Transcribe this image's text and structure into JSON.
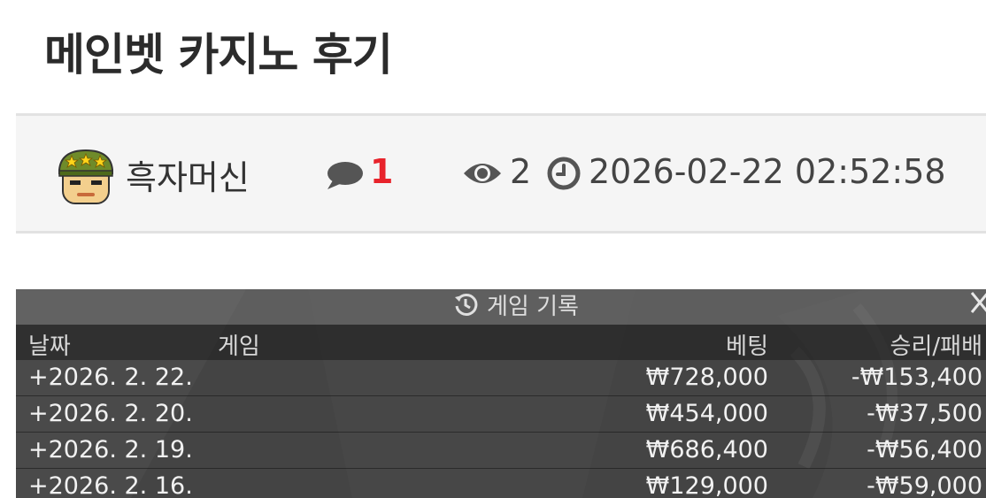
{
  "post": {
    "title": "메인벳 카지노 후기",
    "author": "흑자머신",
    "comment_count": "1",
    "views": "2",
    "datetime": "2026-02-22 02:52:58"
  },
  "game_history": {
    "title": "게임 기록",
    "columns": [
      "날짜",
      "게임",
      "베팅",
      "승리/패배"
    ],
    "rows": [
      {
        "date": "+2026. 2. 22.",
        "game": "",
        "bet": "₩728,000",
        "result": "-₩153,400"
      },
      {
        "date": "+2026. 2. 20.",
        "game": "",
        "bet": "₩454,000",
        "result": "-₩37,500"
      },
      {
        "date": "+2026. 2. 19.",
        "game": "",
        "bet": "₩686,400",
        "result": "-₩56,400"
      },
      {
        "date": "+2026. 2. 16.",
        "game": "",
        "bet": "₩129,000",
        "result": "-₩59,000"
      }
    ]
  },
  "icons": {
    "comment": "comment-icon",
    "views": "eye-icon",
    "time": "clock-icon",
    "history": "history-icon",
    "close": "close-icon"
  },
  "colors": {
    "comment_count": "#e8232b",
    "meta_bar_bg": "#f5f5f5",
    "icon": "#555555"
  }
}
